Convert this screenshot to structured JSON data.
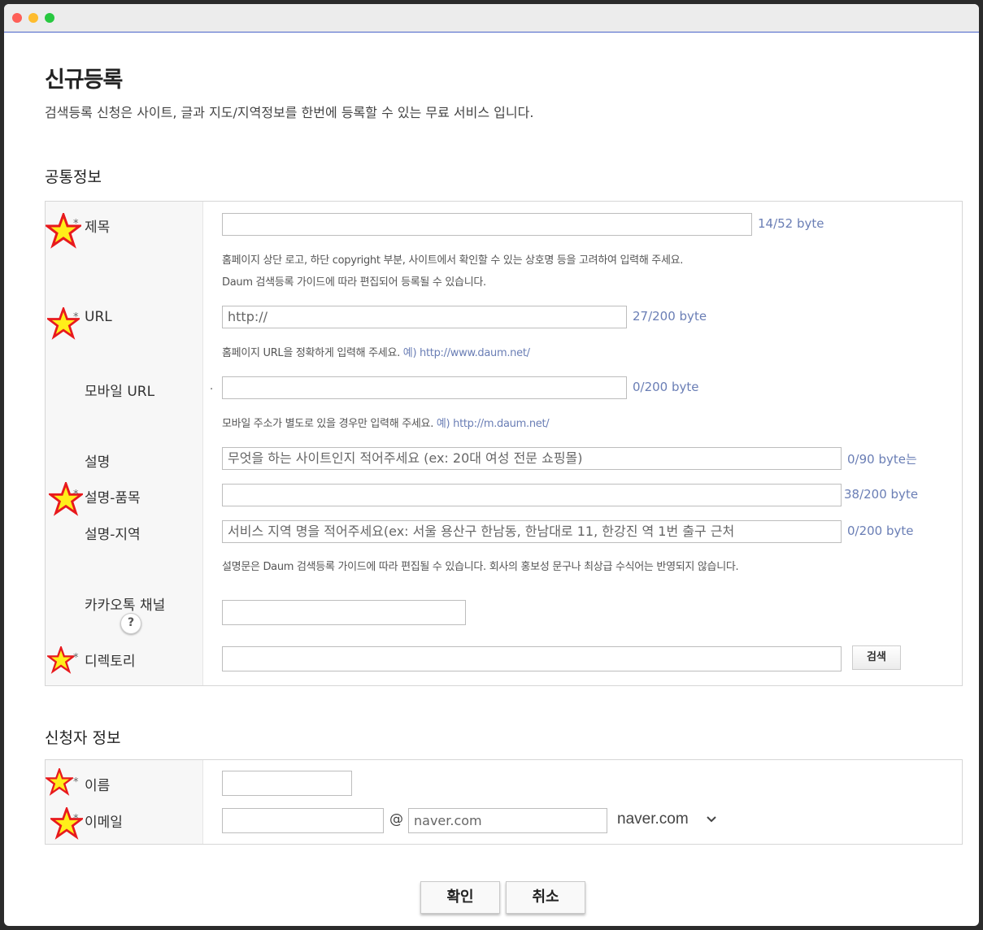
{
  "page": {
    "title": "신규등록",
    "subtitle": "검색등록 신청은 사이트, 글과 지도/지역정보를 한번에 등록할 수 있는 무료 서비스 입니다."
  },
  "common_section": {
    "title": "공통정보",
    "required_mark": "*",
    "fields": {
      "title": {
        "label": "제목",
        "value": "",
        "bytes": "14/52 byte"
      },
      "title_help_1": "홈페이지 상단 로고, 하단 copyright 부분, 사이트에서 확인할 수 있는 상호명 등을 고려하여 입력해 주세요.",
      "title_help_2": "Daum 검색등록 가이드에 따라 편집되어 등록될 수 있습니다.",
      "url": {
        "label": "URL",
        "value": "http://",
        "bytes": "27/200 byte"
      },
      "url_help": "홈페이지 URL을 정확하게 입력해 주세요.",
      "url_help_ex": "예) http://www.daum.net/",
      "mobile_url": {
        "label": "모바일 URL",
        "value": "",
        "bytes": "0/200 byte",
        "dot": "."
      },
      "mobile_help": "모바일 주소가 별도로 있을 경우만 입력해 주세요.",
      "mobile_help_ex": "예) http://m.daum.net/",
      "desc": {
        "label": "설명",
        "placeholder": "무엇을 하는 사이트인지 적어주세요 (ex: 20대 여성 전문 쇼핑몰)",
        "bytes": "0/90 byte는"
      },
      "desc_item": {
        "label": "설명-품목",
        "value": "",
        "bytes": "38/200 byte"
      },
      "desc_region": {
        "label": "설명-지역",
        "placeholder": "서비스 지역 명을 적어주세요(ex: 서울  용산구 한남동, 한남대로 11, 한강진 역 1번 출구 근처",
        "bytes": "0/200 byte"
      },
      "desc_help": "설명문은 Daum 검색등록 가이드에 따라 편집될 수 있습니다. 회사의 홍보성 문구나 최상급 수식어는 반영되지 않습니다.",
      "kakao": {
        "label": "카카오톡 채널",
        "help_icon": "?",
        "value": ""
      },
      "directory": {
        "label": "디렉토리",
        "value": "",
        "search_button": "검색"
      }
    }
  },
  "applicant_section": {
    "title": "신청자 정보",
    "name": {
      "label": "이름",
      "value": ""
    },
    "email": {
      "label": "이메일",
      "local": "",
      "at": "@",
      "domain_value": "naver.com",
      "domain_select": "naver.com"
    }
  },
  "buttons": {
    "confirm": "확인",
    "cancel": "취소"
  },
  "icons": {
    "star_fill": "#ffee1a",
    "star_stroke": "#e8191d"
  }
}
